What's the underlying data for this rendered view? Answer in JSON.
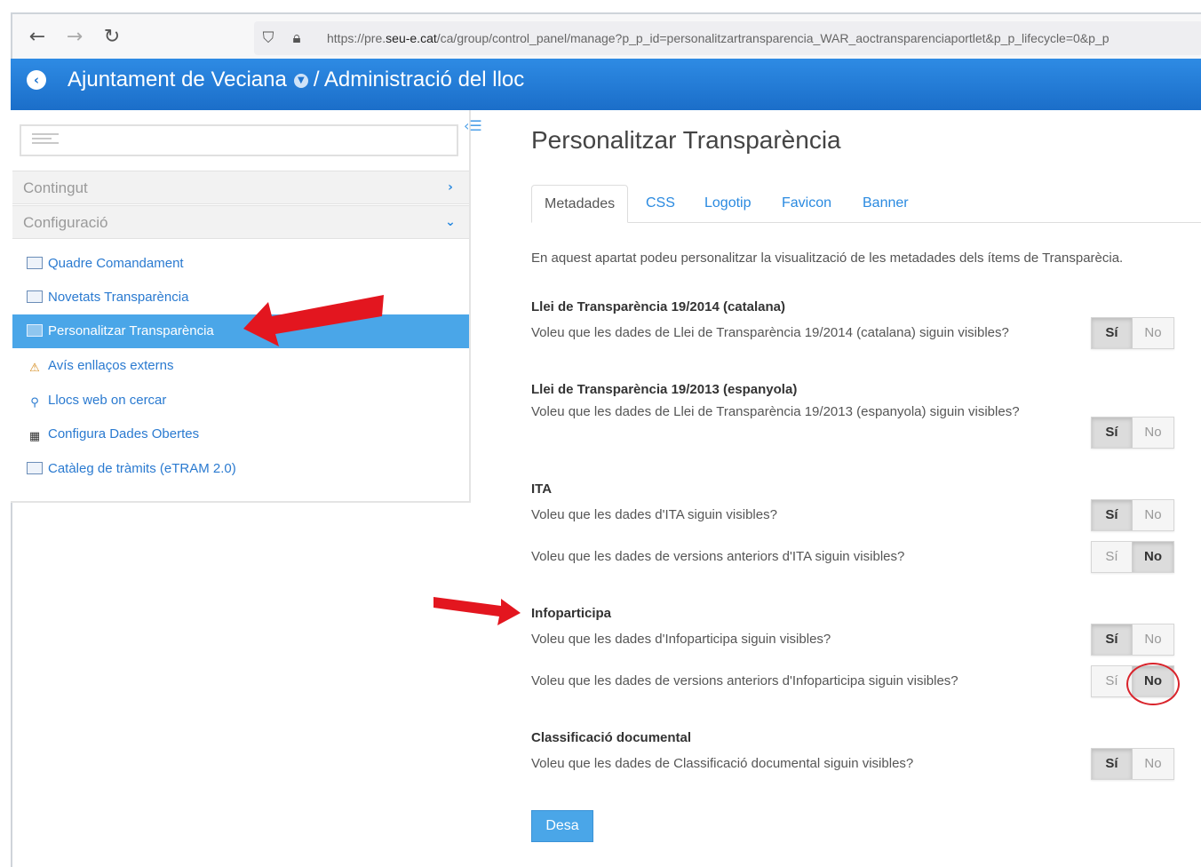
{
  "browser": {
    "url_prefix": "https://pre.",
    "url_host": "seu-e.cat",
    "url_rest": "/ca/group/control_panel/manage?p_p_id=personalitzartransparencia_WAR_aoctransparenciaportlet&p_p_lifecycle=0&p_p"
  },
  "header": {
    "site_name": "Ajuntament de Veciana",
    "section": "/ Administració del lloc"
  },
  "sidebar": {
    "panels": [
      {
        "label": "Contingut"
      },
      {
        "label": "Configuració"
      }
    ],
    "items": [
      {
        "label": "Quadre Comandament"
      },
      {
        "label": "Novetats Transparència"
      },
      {
        "label": "Personalitzar Transparència"
      },
      {
        "label": "Avís enllaços externs"
      },
      {
        "label": "Llocs web on cercar"
      },
      {
        "label": "Configura Dades Obertes"
      },
      {
        "label": "Catàleg de tràmits (eTRAM 2.0)"
      }
    ]
  },
  "main": {
    "title": "Personalitzar Transparència",
    "tabs": [
      {
        "label": "Metadades"
      },
      {
        "label": "CSS"
      },
      {
        "label": "Logotip"
      },
      {
        "label": "Favicon"
      },
      {
        "label": "Banner"
      }
    ],
    "intro": "En aquest apartat podeu personalitzar la visualització de les metadades dels ítems de Transparècia.",
    "toggle_yes": "Sí",
    "toggle_no": "No",
    "sections": [
      {
        "title": "Llei de Transparència 19/2014 (catalana)",
        "questions": [
          {
            "text": "Voleu que les dades de Llei de Transparència 19/2014 (catalana) siguin visibles?",
            "value": "Sí"
          }
        ]
      },
      {
        "title": "Llei de Transparència 19/2013 (espanyola)",
        "questions": [
          {
            "text": "Voleu que les dades de Llei de Transparència 19/2013 (espanyola) siguin visibles?",
            "value": "Sí"
          }
        ]
      },
      {
        "title": "ITA",
        "questions": [
          {
            "text": "Voleu que les dades d'ITA siguin visibles?",
            "value": "Sí"
          },
          {
            "text": "Voleu que les dades de versions anteriors d'ITA siguin visibles?",
            "value": "No"
          }
        ]
      },
      {
        "title": "Infoparticipa",
        "questions": [
          {
            "text": "Voleu que les dades d'Infoparticipa siguin visibles?",
            "value": "Sí"
          },
          {
            "text": "Voleu que les dades de versions anteriors d'Infoparticipa siguin visibles?",
            "value": "No"
          }
        ]
      },
      {
        "title": "Classificació documental",
        "questions": [
          {
            "text": "Voleu que les dades de Classificació documental siguin visibles?",
            "value": "Sí"
          }
        ]
      }
    ],
    "save_label": "Desa"
  },
  "colors": {
    "header_blue": "#1f74cf",
    "active_item": "#4aa6e8",
    "link_blue": "#2a7ad0",
    "annotation_red": "#e3161f"
  }
}
